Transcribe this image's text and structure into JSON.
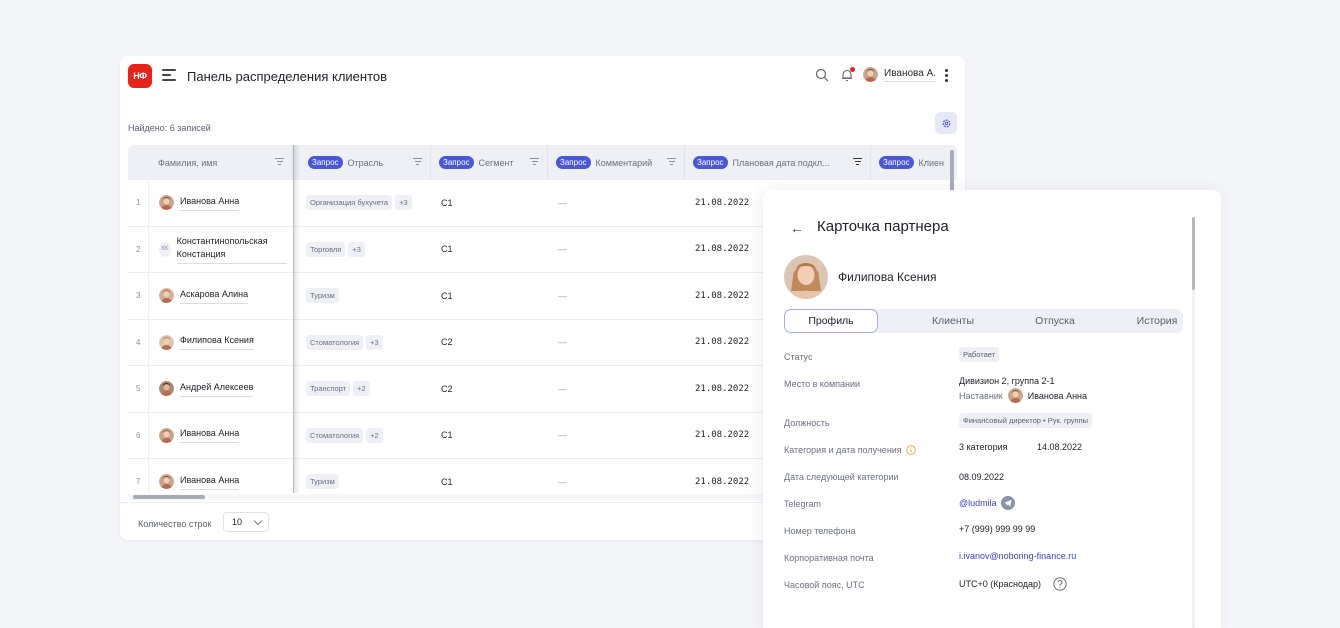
{
  "header": {
    "logo": "НФ",
    "title": "Панель распределения клиентов",
    "user_name": "Иванова А."
  },
  "found_text": "Найдено: 6 записей",
  "table": {
    "req_tag": "Запрос",
    "columns": [
      {
        "label": "Фамилия, имя",
        "req": false
      },
      {
        "label": "Отрасль",
        "req": true
      },
      {
        "label": "Сегмент",
        "req": true
      },
      {
        "label": "Комментарий",
        "req": true
      },
      {
        "label": "Плановая дата подкл...",
        "req": true
      },
      {
        "label": "Клиен",
        "req": true
      }
    ],
    "rows": [
      {
        "num": "1",
        "name": "Иванова Анна",
        "avatar": "photo",
        "industry": "Организация бухучета",
        "extra": "+3",
        "segment": "С1",
        "comment": "—",
        "date": "21.08.2022"
      },
      {
        "num": "2",
        "name": "Константинопольская Констанция",
        "avatar": "initials",
        "initials": "КК",
        "industry": "Торговля",
        "extra": "+3",
        "segment": "С1",
        "comment": "—",
        "date": "21.08.2022"
      },
      {
        "num": "3",
        "name": "Аскарова Алина",
        "avatar": "photo",
        "industry": "Туризм",
        "extra": "",
        "segment": "С1",
        "comment": "—",
        "date": "21.08.2022"
      },
      {
        "num": "4",
        "name": "Филипова  Ксения",
        "avatar": "photo",
        "industry": "Стоматология",
        "extra": "+3",
        "segment": "С2",
        "comment": "—",
        "date": "21.08.2022"
      },
      {
        "num": "5",
        "name": "Андрей Алексеев",
        "avatar": "photo",
        "industry": "Транспорт",
        "extra": "+2",
        "segment": "С2",
        "comment": "—",
        "date": "21.08.2022"
      },
      {
        "num": "6",
        "name": "Иванова Анна",
        "avatar": "photo",
        "industry": "Стоматология",
        "extra": "+2",
        "segment": "С1",
        "comment": "—",
        "date": "21.08.2022"
      },
      {
        "num": "7",
        "name": "Иванова Анна",
        "avatar": "photo",
        "industry": "Туризм",
        "extra": "",
        "segment": "С1",
        "comment": "—",
        "date": "21.08.2022"
      }
    ]
  },
  "footer": {
    "rows_label": "Количество строк",
    "rows_value": "10"
  },
  "card": {
    "title": "Карточка партнера",
    "name": "Филипова Ксения",
    "tabs": [
      "Профиль",
      "Клиенты",
      "Отпуска",
      "История"
    ],
    "fields": {
      "status_label": "Статус",
      "status_value": "Работает",
      "place_label": "Место в компании",
      "place_value": "Дивизион 2, группа 2-1",
      "mentor_label": "Наставник",
      "mentor_name": "Иванова Анна",
      "position_label": "Должность",
      "position_value": "Финансовый директор • Рук. группы",
      "category_label": "Категория и дата получения",
      "category_value": "3 категория",
      "category_date": "14.08.2022",
      "next_label": "Дата следующей категории",
      "next_value": "08.09.2022",
      "telegram_label": "Telegram",
      "telegram_value": "@ludmila",
      "phone_label": "Номер телефона",
      "phone_value": "+7 (999) 999 99 99",
      "email_label": "Корпоративная почта",
      "email_value": "i.ivanov@noboring-finance.ru",
      "tz_label": "Часовой пояс, UTC",
      "tz_value": "UTC+0 (Краснодар)"
    }
  }
}
